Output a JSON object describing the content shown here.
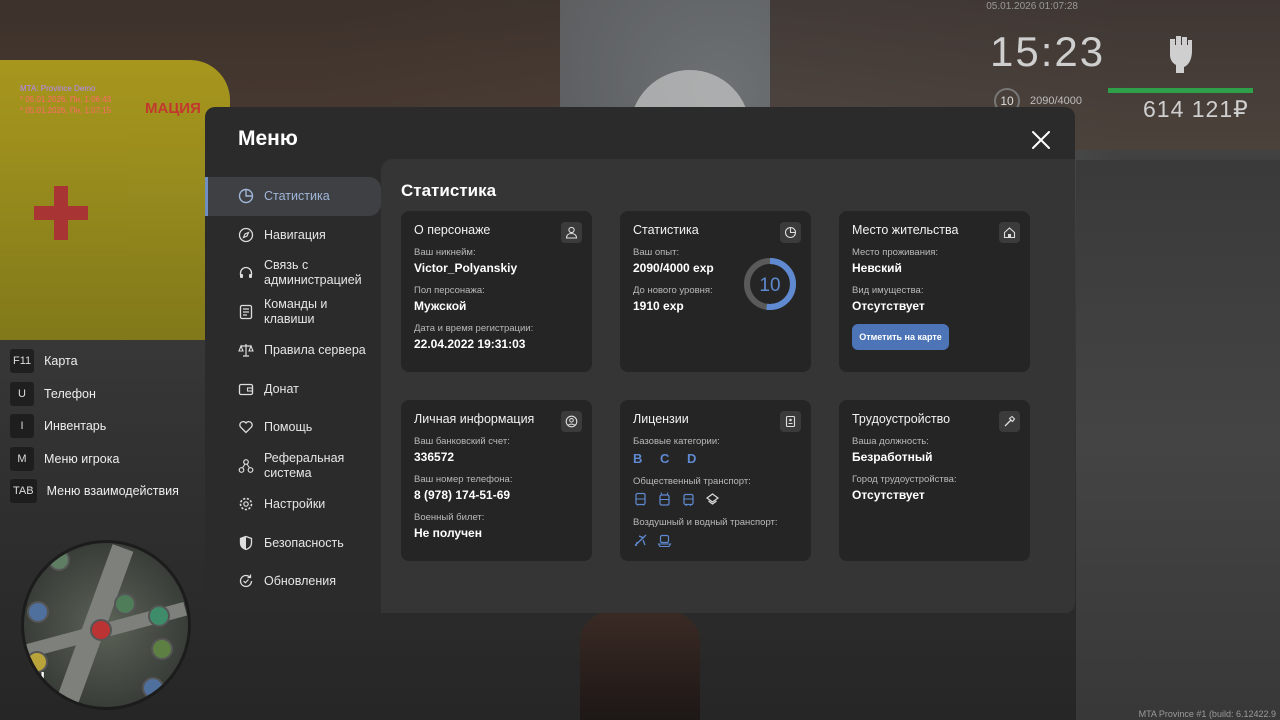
{
  "hud": {
    "server_name": "MTA: Province Demo",
    "log_lines": [
      "* 05.01.2026, Пн, 1:06:43",
      "* 05.01.2026, Пн, 1:07:15"
    ],
    "datetime": "05.01.2026 01:07:28",
    "time": "15:23",
    "level": "10",
    "exp": "2090/4000",
    "money": "614 121₽",
    "build": "MTA Province #1 (build: 6.12422.9",
    "van_label": "МАЦИЯ",
    "health_color": "#2fa04a"
  },
  "hotkeys": [
    {
      "key": "F11",
      "label": "Карта"
    },
    {
      "key": "U",
      "label": "Телефон"
    },
    {
      "key": "I",
      "label": "Инвентарь"
    },
    {
      "key": "M",
      "label": "Меню игрока"
    },
    {
      "key": "TAB",
      "label": "Меню взаимодействия"
    }
  ],
  "minimap": {
    "north": "N"
  },
  "menu": {
    "title": "Меню",
    "nav": [
      {
        "label": "Статистика",
        "icon": "chart-pie-icon",
        "active": true
      },
      {
        "label": "Навигация",
        "icon": "compass-icon"
      },
      {
        "label": "Связь с администрацией",
        "icon": "headset-icon"
      },
      {
        "label": "Команды и клавиши",
        "icon": "keyboard-icon"
      },
      {
        "label": "Правила сервера",
        "icon": "scales-icon"
      },
      {
        "label": "Донат",
        "icon": "wallet-icon"
      },
      {
        "label": "Помощь",
        "icon": "heart-hand-icon"
      },
      {
        "label": "Реферальная система",
        "icon": "referral-icon"
      },
      {
        "label": "Настройки",
        "icon": "gear-icon"
      },
      {
        "label": "Безопасность",
        "icon": "shield-icon"
      },
      {
        "label": "Обновления",
        "icon": "refresh-icon"
      }
    ],
    "accent": "#6f8fc3"
  },
  "stats": {
    "title": "Статистика",
    "character": {
      "title": "О персонаже",
      "nick_label": "Ваш никнейм:",
      "nick": "Victor_Polyanskiy",
      "gender_label": "Пол персонажа:",
      "gender": "Мужской",
      "reg_label": "Дата и время регистрации:",
      "reg": "22.04.2022 19:31:03"
    },
    "statistics": {
      "title": "Статистика",
      "exp_label": "Ваш опыт:",
      "exp": "2090/4000 exp",
      "next_label": "До нового уровня:",
      "next": "1910 exp",
      "level": "10",
      "progress": 0.5225
    },
    "residence": {
      "title": "Место жительства",
      "place_label": "Место проживания:",
      "place": "Невский",
      "property_label": "Вид имущества:",
      "property": "Отсутствует",
      "button": "Отметить на карте"
    },
    "personal": {
      "title": "Личная информация",
      "bank_label": "Ваш банковский счет:",
      "bank": "336572",
      "phone_label": "Ваш номер телефона:",
      "phone": "8 (978) 174-51-69",
      "military_label": "Военный билет:",
      "military": "Не получен"
    },
    "licenses": {
      "title": "Лицензии",
      "base_label": "Базовые категории:",
      "base": "B C D",
      "public_label": "Общественный транспорт:",
      "air_label": "Воздушный и водный транспорт:"
    },
    "employment": {
      "title": "Трудоустройство",
      "position_label": "Ваша должность:",
      "position": "Безработный",
      "city_label": "Город трудоустройства:",
      "city": "Отсутствует"
    }
  }
}
